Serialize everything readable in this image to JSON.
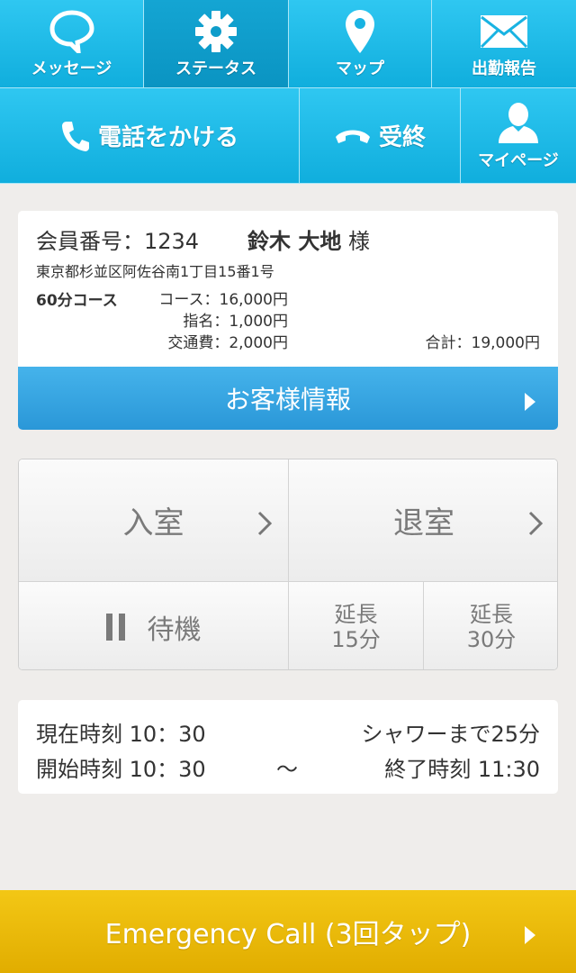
{
  "nav": {
    "message": "メッセージ",
    "status": "ステータス",
    "map": "マップ",
    "attendance": "出勤報告",
    "call": "電話をかける",
    "hangup": "受終",
    "mypage": "マイページ"
  },
  "customer": {
    "member_label": "会員番号：",
    "member_number": "1234",
    "name": "鈴木 大地",
    "honorific": "様",
    "address": "東京都杉並区阿佐谷南1丁目15番1号",
    "course_name": "60分コース",
    "course_price": "コース：16,000円",
    "nomination_price": "指名：1,000円",
    "transport_price": "交通費：2,000円",
    "total": "合計：19,000円",
    "info_button": "お客様情報"
  },
  "actions": {
    "enter": "入室",
    "exit": "退室",
    "wait": "待機",
    "extend15_a": "延長",
    "extend15_b": "15分",
    "extend30_a": "延長",
    "extend30_b": "30分"
  },
  "time": {
    "now": "現在時刻 10：30",
    "shower": "シャワーまで25分",
    "start": "開始時刻 10：30",
    "tilde": "～",
    "end": "終了時刻 11:30"
  },
  "emergency": {
    "label": "Emergency Call (3回タップ)"
  },
  "colors": {
    "nav": "#1bb8e6",
    "info": "#3aa6e2",
    "emergency": "#ecbb08"
  }
}
